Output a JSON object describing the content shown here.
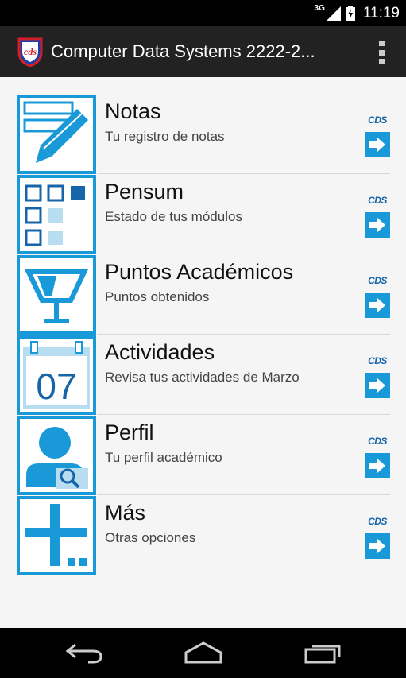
{
  "status_bar": {
    "network": "3G",
    "time": "11:19"
  },
  "app": {
    "title": "Computer Data Systems 2222-2...",
    "logo_text": "cds"
  },
  "menu": [
    {
      "title": "Notas",
      "subtitle": "Tu registro de notas",
      "icon": "grades-pencil-icon",
      "badge": "CDS"
    },
    {
      "title": "Pensum",
      "subtitle": "Estado de tus módulos",
      "icon": "modules-grid-icon",
      "badge": "CDS"
    },
    {
      "title": "Puntos Académicos",
      "subtitle": "Puntos obtenidos",
      "icon": "trophy-cup-icon",
      "badge": "CDS"
    },
    {
      "title": "Actividades",
      "subtitle": "Revisa tus actividades de Marzo",
      "icon": "calendar-icon",
      "badge": "CDS",
      "calendar_day": "07"
    },
    {
      "title": "Perfil",
      "subtitle": "Tu perfil académico",
      "icon": "profile-search-icon",
      "badge": "CDS"
    },
    {
      "title": "Más",
      "subtitle": "Otras opciones",
      "icon": "plus-more-icon",
      "badge": "CDS"
    }
  ],
  "colors": {
    "accent": "#1a99d9",
    "action_bar": "#222222",
    "background": "#f5f5f5",
    "badge_text": "#1565a8"
  },
  "nav_bar": {
    "buttons": [
      "back-icon",
      "home-icon",
      "recent-apps-icon"
    ]
  }
}
